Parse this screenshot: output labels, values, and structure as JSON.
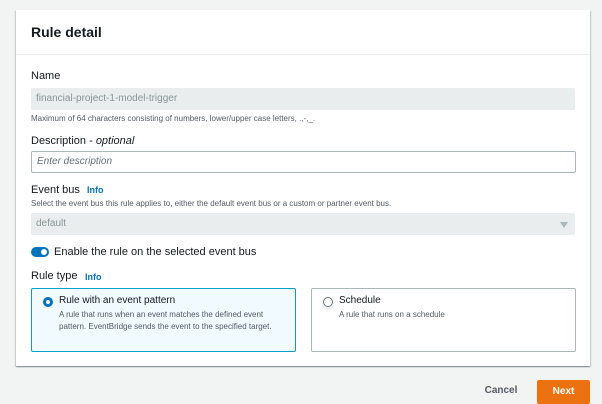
{
  "panel": {
    "title": "Rule detail"
  },
  "name_field": {
    "label": "Name",
    "value": "financial-project-1-model-trigger",
    "hint": "Maximum of 64 characters consisting of numbers, lower/upper case letters, .,-,_."
  },
  "description_field": {
    "label": "Description",
    "label_suffix": " - ",
    "optional": "optional",
    "placeholder": "Enter description"
  },
  "event_bus": {
    "label": "Event bus",
    "info": "Info",
    "hint": "Select the event bus this rule applies to, either the default event bus or a custom or partner event bus.",
    "selected": "default"
  },
  "enable_toggle": {
    "label": "Enable the rule on the selected event bus",
    "checked": true
  },
  "rule_type": {
    "label": "Rule type",
    "info": "Info",
    "options": [
      {
        "title": "Rule with an event pattern",
        "description": "A rule that runs when an event matches the defined event pattern. EventBridge sends the event to the specified target.",
        "selected": true
      },
      {
        "title": "Schedule",
        "description": "A rule that runs on a schedule",
        "selected": false
      }
    ]
  },
  "actions": {
    "cancel": "Cancel",
    "next": "Next"
  },
  "colors": {
    "accent": "#0073bb",
    "primary_button": "#ec7211",
    "selected_tile_border": "#00a1c9"
  }
}
